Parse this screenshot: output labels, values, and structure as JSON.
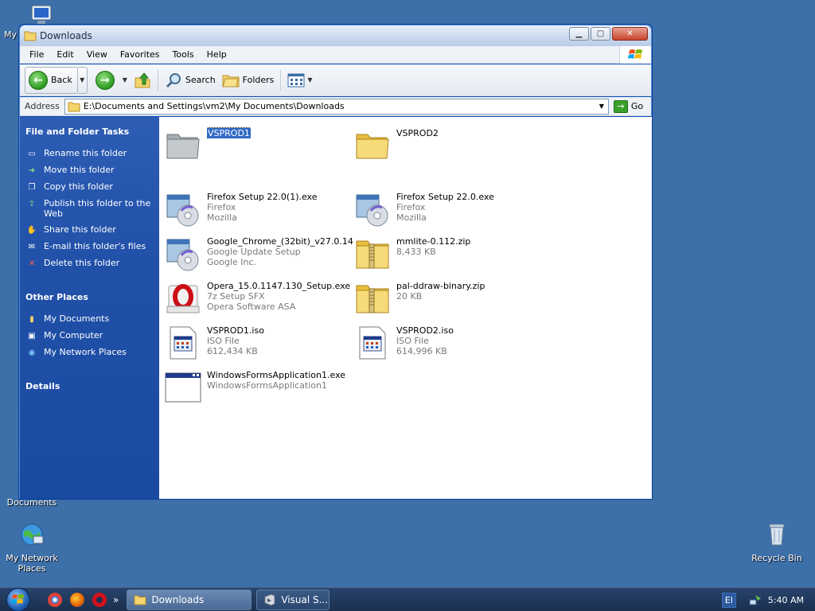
{
  "desktop": {
    "icons": [
      {
        "label": "My",
        "name": "desktop-icon-my-computer"
      },
      {
        "label": "Documents",
        "name": "desktop-icon-documents"
      },
      {
        "label": "My Network Places",
        "name": "desktop-icon-network-places"
      },
      {
        "label": "Recycle Bin",
        "name": "desktop-icon-recycle-bin"
      }
    ]
  },
  "window": {
    "title": "Downloads",
    "menu": [
      "File",
      "Edit",
      "View",
      "Favorites",
      "Tools",
      "Help"
    ],
    "toolbar": {
      "back_label": "Back",
      "search_label": "Search",
      "folders_label": "Folders"
    },
    "address": {
      "label": "Address",
      "value": "E:\\Documents and Settings\\vm2\\My Documents\\Downloads",
      "go_label": "Go"
    }
  },
  "leftpane": {
    "tasks_header": "File and Folder Tasks",
    "tasks": [
      {
        "label": "Rename this folder",
        "icon": "rename-icon"
      },
      {
        "label": "Move this folder",
        "icon": "move-icon"
      },
      {
        "label": "Copy this folder",
        "icon": "copy-icon"
      },
      {
        "label": "Publish this folder to the Web",
        "icon": "publish-web-icon"
      },
      {
        "label": "Share this folder",
        "icon": "share-icon"
      },
      {
        "label": "E-mail this folder's files",
        "icon": "email-icon"
      },
      {
        "label": "Delete this folder",
        "icon": "delete-icon"
      }
    ],
    "places_header": "Other Places",
    "places": [
      {
        "label": "My Documents",
        "icon": "my-documents-icon"
      },
      {
        "label": "My Computer",
        "icon": "my-computer-icon"
      },
      {
        "label": "My Network Places",
        "icon": "network-places-icon"
      }
    ],
    "details_header": "Details"
  },
  "files": [
    {
      "name": "VSPROD1",
      "sub1": "",
      "sub2": "",
      "type": "folder-gray",
      "selected": true
    },
    {
      "name": "VSPROD2",
      "sub1": "",
      "sub2": "",
      "type": "folder",
      "selected": false
    },
    {
      "name": "Firefox Setup 22.0(1).exe",
      "sub1": "Firefox",
      "sub2": "Mozilla",
      "type": "setup"
    },
    {
      "name": "Firefox Setup 22.0.exe",
      "sub1": "Firefox",
      "sub2": "Mozilla",
      "type": "setup"
    },
    {
      "name": "Google_Chrome_(32bit)_v27.0.14...",
      "sub1": "Google Update Setup",
      "sub2": "Google Inc.",
      "type": "setup"
    },
    {
      "name": "mmlite-0.112.zip",
      "sub1": "8,433 KB",
      "sub2": "",
      "type": "zip"
    },
    {
      "name": "Opera_15.0.1147.130_Setup.exe",
      "sub1": "7z Setup SFX",
      "sub2": "Opera Software ASA",
      "type": "opera"
    },
    {
      "name": "pal-ddraw-binary.zip",
      "sub1": "20 KB",
      "sub2": "",
      "type": "zip"
    },
    {
      "name": "VSPROD1.iso",
      "sub1": "ISO File",
      "sub2": "612,434 KB",
      "type": "iso"
    },
    {
      "name": "VSPROD2.iso",
      "sub1": "ISO File",
      "sub2": "614,996 KB",
      "type": "iso"
    },
    {
      "name": "WindowsFormsApplication1.exe",
      "sub1": "WindowsFormsApplication1",
      "sub2": "",
      "type": "app"
    }
  ],
  "taskbar": {
    "tasks": [
      "Downloads",
      "Visual S..."
    ],
    "chevron": "»",
    "lang": "El",
    "clock": "5:40 AM"
  }
}
